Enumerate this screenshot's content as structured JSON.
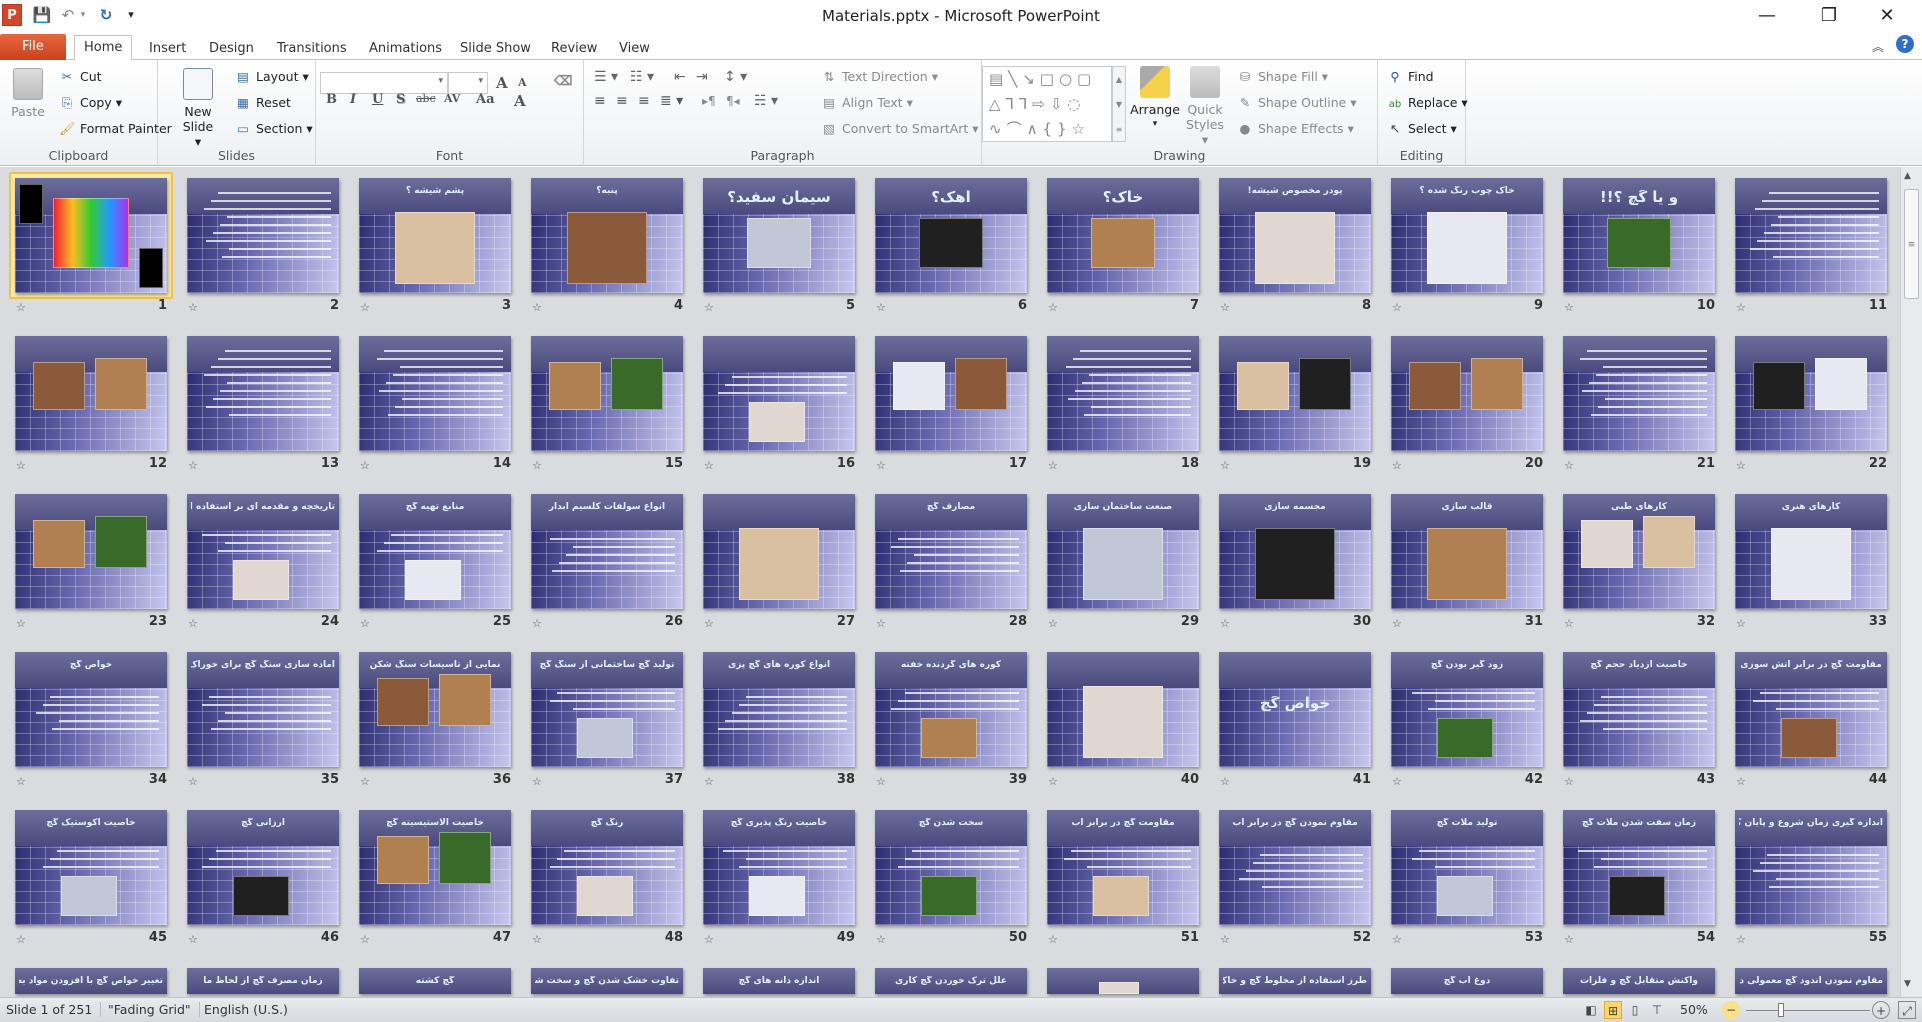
{
  "window": {
    "title": "Materials.pptx - Microsoft PowerPoint",
    "minimize": "—",
    "restore": "❐",
    "close": "✕"
  },
  "quick_access": {
    "app_icon": "P",
    "save": "save-icon",
    "undo": "undo-icon",
    "redo": "redo-icon",
    "customize": "▾"
  },
  "tabs": [
    {
      "label": "File"
    },
    {
      "label": "Home",
      "active": true
    },
    {
      "label": "Insert"
    },
    {
      "label": "Design"
    },
    {
      "label": "Transitions"
    },
    {
      "label": "Animations"
    },
    {
      "label": "Slide Show"
    },
    {
      "label": "Review"
    },
    {
      "label": "View"
    }
  ],
  "ribbon": {
    "clipboard": {
      "label": "Clipboard",
      "paste": "Paste",
      "cut": "Cut",
      "copy": "Copy",
      "format_painter": "Format Painter"
    },
    "slides": {
      "label": "Slides",
      "new_slide_1": "New",
      "new_slide_2": "Slide",
      "layout": "Layout",
      "reset": "Reset",
      "section": "Section"
    },
    "font": {
      "label": "Font",
      "font_name": "",
      "font_size": "",
      "bold": "B",
      "italic": "I",
      "underline": "U",
      "shadow": "S",
      "strike": "abc",
      "spacing": "AV",
      "case": "Aa",
      "color": "A",
      "grow": "A",
      "shrink": "A"
    },
    "paragraph": {
      "label": "Paragraph",
      "text_direction": "Text Direction",
      "align_text": "Align Text",
      "convert_smartart": "Convert to SmartArt"
    },
    "drawing": {
      "label": "Drawing",
      "arrange": "Arrange",
      "quick_styles_1": "Quick",
      "quick_styles_2": "Styles",
      "shape_fill": "Shape Fill",
      "shape_outline": "Shape Outline",
      "shape_effects": "Shape Effects"
    },
    "editing": {
      "label": "Editing",
      "find": "Find",
      "replace": "Replace",
      "select": "Select"
    }
  },
  "accent": {
    "file_tab": "#d24726",
    "selection": "#efc24a",
    "slide_title": "#dff0ff"
  },
  "slides": [
    {
      "n": "1",
      "title": "",
      "kind": "calligraphy",
      "selected": true
    },
    {
      "n": "2",
      "title": "",
      "kind": "text"
    },
    {
      "n": "3",
      "title": "پشم شیشه ؟",
      "kind": "title-image"
    },
    {
      "n": "4",
      "title": "پنبه؟",
      "kind": "title-image"
    },
    {
      "n": "5",
      "title": "سیمان سفید؟",
      "kind": "big-image"
    },
    {
      "n": "6",
      "title": "آهک؟",
      "kind": "big-image"
    },
    {
      "n": "7",
      "title": "خاک؟",
      "kind": "big-image"
    },
    {
      "n": "8",
      "title": "پودر مخصوص شیشه!",
      "kind": "title-image"
    },
    {
      "n": "9",
      "title": "خاک چوب رنگ شده ؟",
      "kind": "title-image"
    },
    {
      "n": "10",
      "title": "و یا گچ ؟!!",
      "kind": "big-image"
    },
    {
      "n": "11",
      "title": "",
      "kind": "text"
    },
    {
      "n": "12",
      "title": "",
      "kind": "images"
    },
    {
      "n": "13",
      "title": "",
      "kind": "text"
    },
    {
      "n": "14",
      "title": "",
      "kind": "text"
    },
    {
      "n": "15",
      "title": "",
      "kind": "images"
    },
    {
      "n": "16",
      "title": "",
      "kind": "text-image"
    },
    {
      "n": "17",
      "title": "",
      "kind": "images"
    },
    {
      "n": "18",
      "title": "",
      "kind": "text"
    },
    {
      "n": "19",
      "title": "",
      "kind": "images"
    },
    {
      "n": "20",
      "title": "",
      "kind": "images"
    },
    {
      "n": "21",
      "title": "",
      "kind": "text"
    },
    {
      "n": "22",
      "title": "",
      "kind": "images"
    },
    {
      "n": "23",
      "title": "",
      "kind": "images"
    },
    {
      "n": "24",
      "title": "تاریخچه و مقدمه ای بر استفاده از گچ",
      "kind": "text-image"
    },
    {
      "n": "25",
      "title": "منابع تهیه گچ",
      "kind": "text-image"
    },
    {
      "n": "26",
      "title": "انواع سولفات کلسیم آبدار",
      "kind": "title-text"
    },
    {
      "n": "27",
      "title": "",
      "kind": "title-image"
    },
    {
      "n": "28",
      "title": "مصارف گچ",
      "kind": "title-text"
    },
    {
      "n": "29",
      "title": "صنعت ساختمان سازی",
      "kind": "title-image"
    },
    {
      "n": "30",
      "title": "مجسمه سازی",
      "kind": "title-image"
    },
    {
      "n": "31",
      "title": "قالب سازی",
      "kind": "title-image"
    },
    {
      "n": "32",
      "title": "کارهای طبی",
      "kind": "images"
    },
    {
      "n": "33",
      "title": "کارهای هنری",
      "kind": "title-image"
    },
    {
      "n": "34",
      "title": "خواص گچ",
      "kind": "title-text"
    },
    {
      "n": "35",
      "title": "آماده سازی سنگ گچ برای خوراک کوره",
      "kind": "title-text"
    },
    {
      "n": "36",
      "title": "نمایی از تاسیسات سنگ شکن",
      "kind": "images"
    },
    {
      "n": "37",
      "title": "تولید گچ ساختمانی از سنگ گچ",
      "kind": "text-image"
    },
    {
      "n": "38",
      "title": "انواع کوره های گچ پزی",
      "kind": "title-text"
    },
    {
      "n": "39",
      "title": "کوره های گردنده خفته",
      "kind": "text-image"
    },
    {
      "n": "40",
      "title": "",
      "kind": "title-image"
    },
    {
      "n": "41",
      "title": "خواص گچ",
      "kind": "big-center"
    },
    {
      "n": "42",
      "title": "زود گیر بودن گچ",
      "kind": "text-image"
    },
    {
      "n": "43",
      "title": "خاصیت ازدیاد حجم گچ",
      "kind": "title-text"
    },
    {
      "n": "44",
      "title": "مقاومت گچ در برابر آتش سوزی",
      "kind": "text-image"
    },
    {
      "n": "45",
      "title": "خاصیت آکوستیک گچ",
      "kind": "text-image"
    },
    {
      "n": "46",
      "title": "ارزانی گچ",
      "kind": "text-image"
    },
    {
      "n": "47",
      "title": "خاصیت الاستیسیته گچ",
      "kind": "images"
    },
    {
      "n": "48",
      "title": "رنگ گچ",
      "kind": "text-image"
    },
    {
      "n": "49",
      "title": "خاصیت رنگ پذیری گچ",
      "kind": "text-image"
    },
    {
      "n": "50",
      "title": "سخت شدن گچ",
      "kind": "text-image"
    },
    {
      "n": "51",
      "title": "مقاومت گچ در برابر آب",
      "kind": "text-image"
    },
    {
      "n": "52",
      "title": "مقاوم نمودن گچ در برابر آب",
      "kind": "title-text"
    },
    {
      "n": "53",
      "title": "تولید ملات گچ",
      "kind": "text-image"
    },
    {
      "n": "54",
      "title": "زمان سفت شدن ملات گچ",
      "kind": "text-image"
    },
    {
      "n": "55",
      "title": "اندازه گیری زمان شروع و پایان گرفتن گچ",
      "kind": "title-text"
    },
    {
      "n": "56",
      "title": "تغییر خواص گچ با افزودن مواد به آن",
      "kind": "title-text"
    },
    {
      "n": "57",
      "title": "زمان مصرف گچ از لحاظ ما",
      "kind": "title-text"
    },
    {
      "n": "58",
      "title": "گچ کشته",
      "kind": "title-text"
    },
    {
      "n": "59",
      "title": "تفاوت خشک شدن گچ و سخت شدن آن",
      "kind": "title-text"
    },
    {
      "n": "60",
      "title": "اندازه دانه های گچ",
      "kind": "title-text"
    },
    {
      "n": "61",
      "title": "علل ترک خوردن گچ کاری",
      "kind": "title-text"
    },
    {
      "n": "62",
      "title": "",
      "kind": "title-image"
    },
    {
      "n": "63",
      "title": "طرز استفاده از مخلوط گچ و خاک رس",
      "kind": "title-text"
    },
    {
      "n": "64",
      "title": "دوغ آب گچ",
      "kind": "title-text"
    },
    {
      "n": "65",
      "title": "واکنش متقابل گچ و فلزات",
      "kind": "title-text"
    },
    {
      "n": "66",
      "title": "مقاوم نمودن اندود گچ معمولی در برابر آب",
      "kind": "title-text"
    }
  ],
  "status": {
    "slide_info": "Slide 1 of 251",
    "theme": "\"Fading Grid\"",
    "language": "English (U.S.)",
    "zoom": "50%",
    "zoom_percent": 50
  }
}
